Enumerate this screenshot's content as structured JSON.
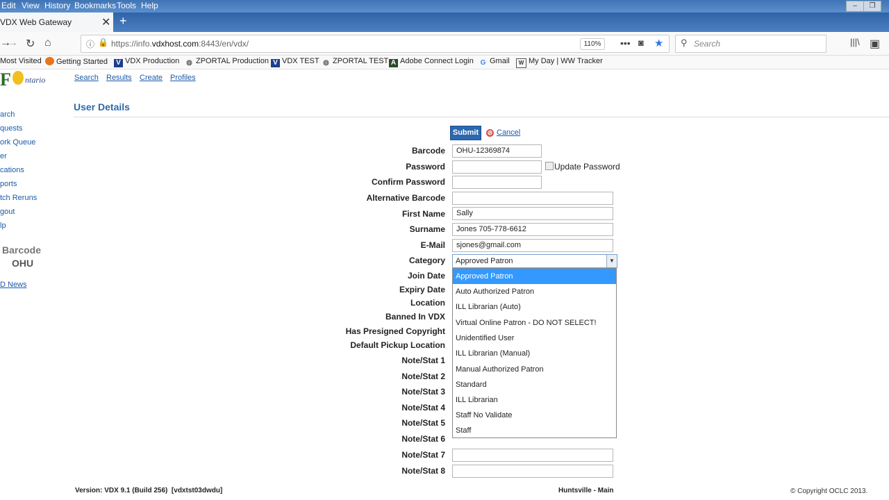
{
  "menubar": {
    "items": [
      "Edit",
      "View",
      "History",
      "Bookmarks",
      "Tools",
      "Help"
    ]
  },
  "tab": {
    "title": "VDX Web Gateway",
    "close": "✕"
  },
  "navbar": {
    "url_prefix": "https://info.",
    "url_domain": "vdxhost.com",
    "url_suffix": ":8443/en/vdx/",
    "zoom": "110%",
    "search_placeholder": "Search"
  },
  "bookmarks": [
    {
      "label": "Most Visited",
      "icon": "none"
    },
    {
      "label": "Getting Started",
      "icon": "firefox-icon"
    },
    {
      "label": "VDX Production",
      "icon": "vdx-icon"
    },
    {
      "label": "ZPORTAL Production",
      "icon": "globe-icon"
    },
    {
      "label": "VDX TEST",
      "icon": "vdx-icon"
    },
    {
      "label": "ZPORTAL TEST",
      "icon": "globe-icon"
    },
    {
      "label": "Adobe Connect Login",
      "icon": "adobe-icon"
    },
    {
      "label": "Gmail",
      "icon": "google-icon"
    },
    {
      "label": "My Day | WW Tracker",
      "icon": "ww-icon"
    }
  ],
  "logo": {
    "big": "F",
    "small": "ntario"
  },
  "toplinks": [
    "Search",
    "Results",
    "Create",
    "Profiles"
  ],
  "page": {
    "title": "User Details"
  },
  "sidebar": {
    "links": [
      "arch",
      "quests",
      "ork Queue",
      "er",
      "cations",
      "ports",
      "tch Reruns",
      "gout",
      "lp"
    ],
    "barcode_label": "Barcode",
    "barcode_value": "OHU",
    "news": "D News"
  },
  "form": {
    "submit_label": "Submit",
    "cancel_label": "Cancel",
    "labels": {
      "barcode": "Barcode",
      "password": "Password",
      "confirm_password": "Confirm Password",
      "alt_barcode": "Alternative Barcode",
      "first_name": "First Name",
      "surname": "Surname",
      "email": "E-Mail",
      "category": "Category",
      "join_date": "Join Date",
      "expiry_date": "Expiry Date",
      "location": "Location",
      "banned": "Banned In VDX",
      "copyright": "Has Presigned Copyright",
      "pickup": "Default Pickup Location",
      "note1": "Note/Stat 1",
      "note2": "Note/Stat 2",
      "note3": "Note/Stat 3",
      "note4": "Note/Stat 4",
      "note5": "Note/Stat 5",
      "note6": "Note/Stat 6",
      "note7": "Note/Stat 7",
      "note8": "Note/Stat 8"
    },
    "values": {
      "barcode": "OHU-12369874",
      "password": "",
      "confirm_password": "",
      "alt_barcode": "",
      "first_name": "Sally",
      "surname": "Jones  705-778-6612",
      "email": "sjones@gmail.com",
      "category": "Approved Patron",
      "note7": "",
      "note8": ""
    },
    "update_password_label": "Update Password",
    "category_options": [
      "Approved Patron",
      "Auto Authorized Patron",
      "ILL Librarian (Auto)",
      "Virtual Online Patron - DO NOT SELECT!",
      "Unidentified User",
      "ILL Librarian (Manual)",
      "Manual Authorized Patron",
      "Standard",
      "ILL Librarian",
      "Staff No Validate",
      "Staff"
    ]
  },
  "footer": {
    "version": "Version: VDX 9.1 (Build 256)  [vdxtst03dwdu]",
    "location": "Huntsville - Main",
    "copyright": "© Copyright OCLC 2013."
  }
}
